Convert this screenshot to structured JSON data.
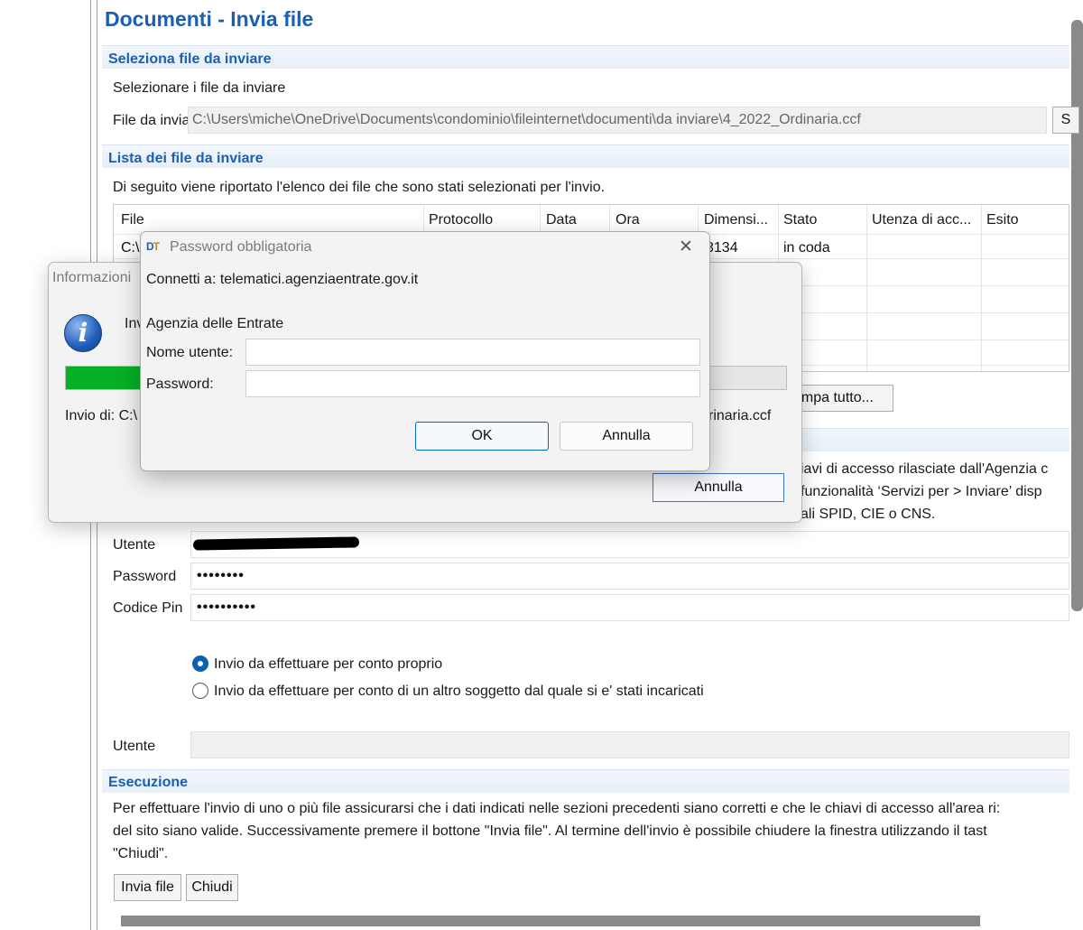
{
  "main": {
    "title": "Documenti - Invia file",
    "section_select": {
      "title": "Seleziona file da inviare",
      "instruction": "Selezionare i file da inviare",
      "file_label": "File da inviare",
      "file_value": "C:\\Users\\miche\\OneDrive\\Documents\\condominio\\fileinternet\\documenti\\da inviare\\4_2022_Ordinaria.ccf",
      "browse_label": "S"
    },
    "section_list": {
      "title": "Lista dei file da inviare",
      "description": "Di seguito viene riportato l'elenco dei file che sono stati selezionati per l'invio.",
      "columns": [
        "File",
        "Protocollo",
        "Data",
        "Ora",
        "Dimensi...",
        "Stato",
        "Utenza di acc...",
        "Esito"
      ],
      "rows": [
        {
          "file": "C:\\",
          "size": "3134",
          "status": "in coda"
        }
      ],
      "print_all_label": "ampa tutto..."
    },
    "section_credentials": {
      "description_lines": [
        "iavi di accesso rilasciate dall'Agenzia c",
        " funzionalità ‘Servizi per > Inviare’ disp",
        "ali SPID, CIE o CNS."
      ],
      "user_label": "Utente",
      "password_label": "Password",
      "password_value": "••••••••",
      "pin_label": "Codice Pin",
      "pin_value": "••••••••••",
      "radio_own": "Invio da effettuare per conto proprio",
      "radio_other": "Invio da effettuare per conto di un altro soggetto dal quale si e' stati incaricati",
      "delegate_user_label": "Utente"
    },
    "section_execution": {
      "title": "Esecuzione",
      "text_lines": [
        "Per effettuare l'invio di uno o più file assicurarsi che i dati indicati nelle sezioni precedenti siano corretti e che le chiavi di accesso all'area ri:",
        "del sito siano valide. Successivamente premere il bottone \"Invia file\". Al termine dell'invio è possibile chiudere la finestra utilizzando il tast",
        "\"Chiudi\"."
      ],
      "send_label": "Invia file",
      "close_label": "Chiudi"
    }
  },
  "info_dialog": {
    "title": "Informazioni",
    "message_fragment": "Inv",
    "progress_percent": 100,
    "sending_label": "Invio di: C:\\",
    "sending_file_tail": "rinaria.ccf",
    "cancel_label": "Annulla"
  },
  "password_dialog": {
    "title": "Password obbligatoria",
    "connect_text": "Connetti a: telematici.agenziaentrate.gov.it",
    "realm": "Agenzia delle Entrate",
    "username_label": "Nome utente:",
    "password_label": "Password:",
    "ok_label": "OK",
    "cancel_label": "Annulla",
    "close_glyph": "✕"
  },
  "colors": {
    "accent_blue": "#1a5fb4",
    "progress_green": "#06b025",
    "radio_blue": "#0c5fb3"
  }
}
